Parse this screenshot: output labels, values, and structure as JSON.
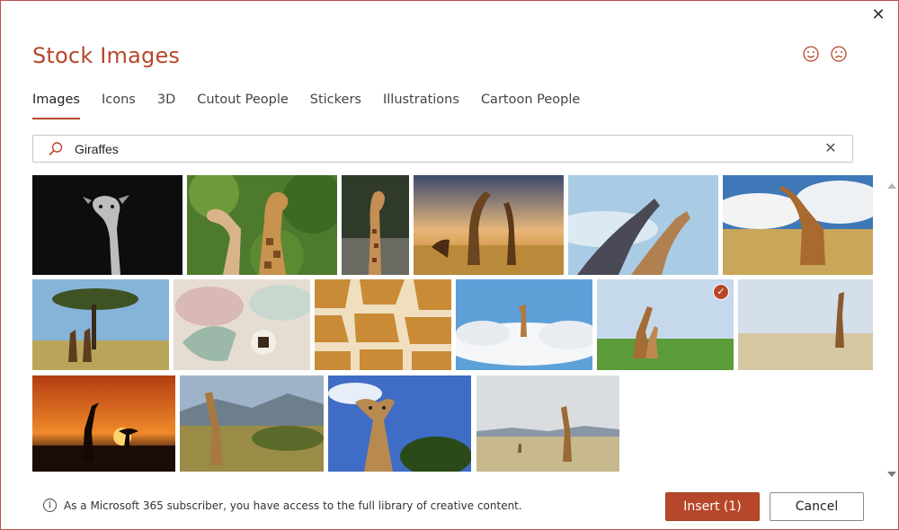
{
  "dialog": {
    "title": "Stock Images",
    "close_label": "✕"
  },
  "tabs": [
    {
      "label": "Images",
      "active": true
    },
    {
      "label": "Icons",
      "active": false
    },
    {
      "label": "3D",
      "active": false
    },
    {
      "label": "Cutout People",
      "active": false
    },
    {
      "label": "Stickers",
      "active": false
    },
    {
      "label": "Illustrations",
      "active": false
    },
    {
      "label": "Cartoon People",
      "active": false
    }
  ],
  "search": {
    "value": "Giraffes",
    "clear_label": "✕"
  },
  "results": [
    {
      "subject": "black and white giraffe portrait",
      "selected": false
    },
    {
      "subject": "two giraffes in green forest",
      "selected": false
    },
    {
      "subject": "giraffe standing by rocks",
      "selected": false
    },
    {
      "subject": "giraffes at sunset savanna",
      "selected": false
    },
    {
      "subject": "two giraffes against blue sky",
      "selected": false
    },
    {
      "subject": "giraffe on savanna with clouds",
      "selected": false
    },
    {
      "subject": "giraffes under acacia tree",
      "selected": false
    },
    {
      "subject": "giraffe plush toy on bed",
      "selected": false
    },
    {
      "subject": "giraffe skin pattern",
      "selected": false
    },
    {
      "subject": "giraffe above the clouds",
      "selected": false
    },
    {
      "subject": "mother and baby giraffe on grass",
      "selected": true
    },
    {
      "subject": "giraffe on dry plain",
      "selected": false
    },
    {
      "subject": "giraffe silhouette at sunset",
      "selected": false
    },
    {
      "subject": "giraffe in hills",
      "selected": false
    },
    {
      "subject": "giraffe looking down blue sky",
      "selected": false
    },
    {
      "subject": "giraffe in desert landscape",
      "selected": false
    }
  ],
  "footer": {
    "info_text": "As a Microsoft 365 subscriber, you have access to the full library of creative content.",
    "insert_label": "Insert (1)",
    "cancel_label": "Cancel"
  },
  "colors": {
    "accent": "#b7472a"
  }
}
